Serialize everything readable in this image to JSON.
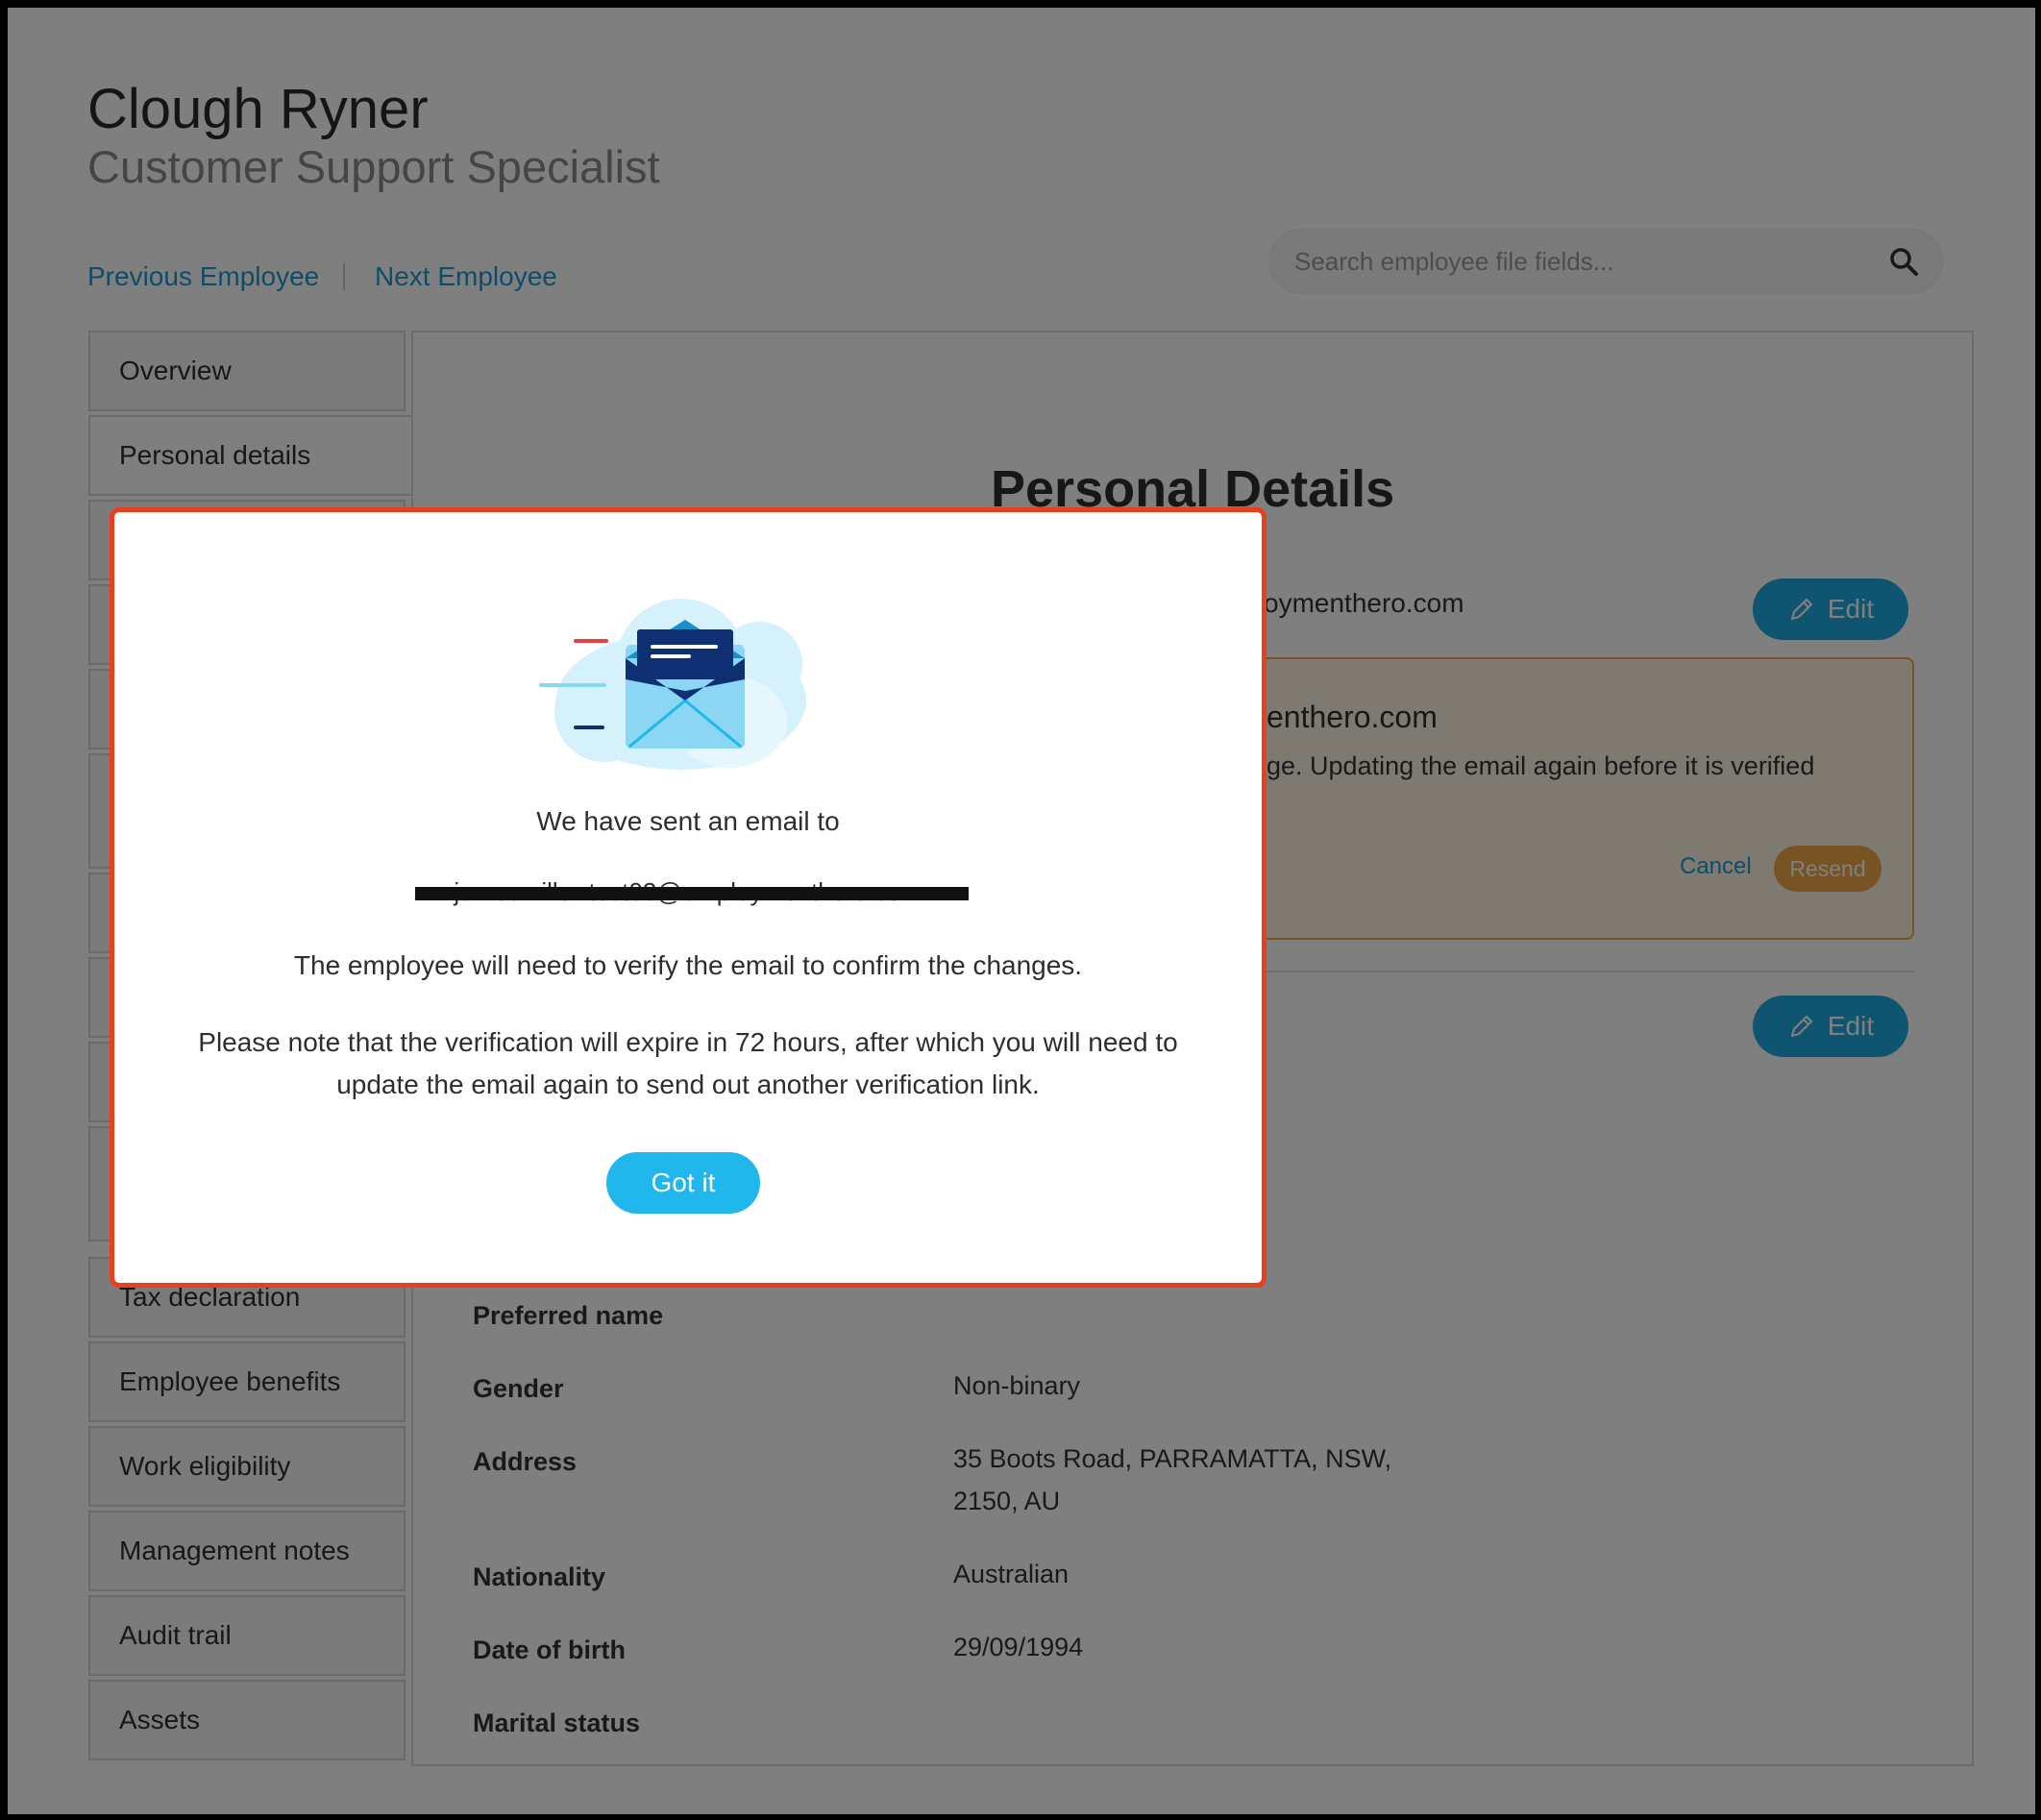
{
  "employee": {
    "name": "Clough Ryner",
    "title": "Customer Support Specialist"
  },
  "nav": {
    "previous": "Previous Employee",
    "next": "Next Employee"
  },
  "search": {
    "placeholder": "Search employee file fields..."
  },
  "sidebar": {
    "items": [
      {
        "label": "Overview"
      },
      {
        "label": "Personal details"
      },
      {
        "label": "Tax declaration"
      },
      {
        "label": "Employee benefits"
      },
      {
        "label": "Work eligibility"
      },
      {
        "label": "Management notes"
      },
      {
        "label": "Audit trail"
      },
      {
        "label": "Assets"
      }
    ]
  },
  "main": {
    "heading": "Personal Details",
    "email_partial": "oymenthero.com",
    "edit_label": "Edit",
    "pending": {
      "email_partial": "enthero.com",
      "note_partial": "ge. Updating the email again before it is verified",
      "cancel": "Cancel",
      "resend": "Resend"
    },
    "fields": [
      {
        "label": "Preferred name",
        "value": ""
      },
      {
        "label": "Gender",
        "value": "Non-binary"
      },
      {
        "label": "Address",
        "value_line1": "35 Boots Road, PARRAMATTA, NSW,",
        "value_line2": "2150, AU"
      },
      {
        "label": "Nationality",
        "value": "Australian"
      },
      {
        "label": "Date of birth",
        "value": "29/09/1994"
      },
      {
        "label": "Marital status",
        "value": ""
      }
    ]
  },
  "modal": {
    "line1": "We have sent an email to",
    "email": "jamesmiller-test03@employmenthero.com",
    "line2": "The employee will need to verify the email to confirm the changes.",
    "line3": "Please note that the verification will expire in 72 hours, after which you will need to update the email again to send out another verification link.",
    "button": "Got it"
  },
  "colors": {
    "accent": "#1fa9e1",
    "modal_border": "#e8401f",
    "pending_border": "#f0a84a",
    "link": "#1b9ad1"
  }
}
